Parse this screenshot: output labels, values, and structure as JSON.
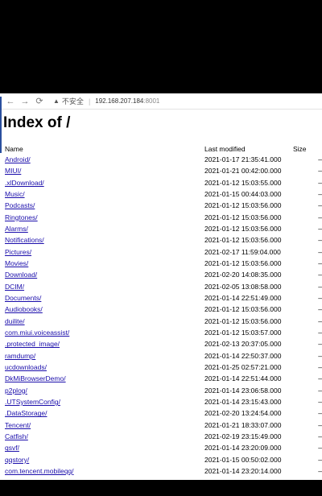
{
  "toolbar": {
    "back_icon": "←",
    "forward_icon": "→",
    "reload_icon": "⟳",
    "security_label": "不安全",
    "url_host": "192.168.207.184",
    "url_port": ":8001"
  },
  "page": {
    "title": "Index of /"
  },
  "table": {
    "headers": [
      "Name",
      "Last modified",
      "Size"
    ],
    "rows": [
      {
        "name": "Android/",
        "modified": "2021-01-17 21:35:41.000",
        "size": "–"
      },
      {
        "name": "MIUI/",
        "modified": "2021-01-21 00:42:00.000",
        "size": "–"
      },
      {
        "name": ".xlDownload/",
        "modified": "2021-01-12 15:03:55.000",
        "size": "–"
      },
      {
        "name": "Music/",
        "modified": "2021-01-15 00:44:03.000",
        "size": "–"
      },
      {
        "name": "Podcasts/",
        "modified": "2021-01-12 15:03:56.000",
        "size": "–"
      },
      {
        "name": "Ringtones/",
        "modified": "2021-01-12 15:03:56.000",
        "size": "–"
      },
      {
        "name": "Alarms/",
        "modified": "2021-01-12 15:03:56.000",
        "size": "–"
      },
      {
        "name": "Notifications/",
        "modified": "2021-01-12 15:03:56.000",
        "size": "–"
      },
      {
        "name": "Pictures/",
        "modified": "2021-02-17 11:59:04.000",
        "size": "–"
      },
      {
        "name": "Movies/",
        "modified": "2021-01-12 15:03:56.000",
        "size": "–"
      },
      {
        "name": "Download/",
        "modified": "2021-02-20 14:08:35.000",
        "size": "–"
      },
      {
        "name": "DCIM/",
        "modified": "2021-02-05 13:08:58.000",
        "size": "–"
      },
      {
        "name": "Documents/",
        "modified": "2021-01-14 22:51:49.000",
        "size": "–"
      },
      {
        "name": "Audiobooks/",
        "modified": "2021-01-12 15:03:56.000",
        "size": "–"
      },
      {
        "name": "duilite/",
        "modified": "2021-01-12 15:03:56.000",
        "size": "–"
      },
      {
        "name": "com.miui.voiceassist/",
        "modified": "2021-01-12 15:03:57.000",
        "size": "–"
      },
      {
        "name": ".protected_image/",
        "modified": "2021-02-13 20:37:05.000",
        "size": "–"
      },
      {
        "name": "ramdump/",
        "modified": "2021-01-14 22:50:37.000",
        "size": "–"
      },
      {
        "name": "ucdownloads/",
        "modified": "2021-01-25 02:57:21.000",
        "size": "–"
      },
      {
        "name": "DkMiBrowserDemo/",
        "modified": "2021-01-14 22:51:44.000",
        "size": "–"
      },
      {
        "name": "p2plog/",
        "modified": "2021-01-14 23:06:58.000",
        "size": "–"
      },
      {
        "name": ".UTSystemConfig/",
        "modified": "2021-01-14 23:15:43.000",
        "size": "–"
      },
      {
        "name": ".DataStorage/",
        "modified": "2021-02-20 13:24:54.000",
        "size": "–"
      },
      {
        "name": "Tencent/",
        "modified": "2021-01-21 18:33:07.000",
        "size": "–"
      },
      {
        "name": "Catfish/",
        "modified": "2021-02-19 23:15:49.000",
        "size": "–"
      },
      {
        "name": "qsvf/",
        "modified": "2021-01-14 23:20:09.000",
        "size": "–"
      },
      {
        "name": "qqstory/",
        "modified": "2021-01-15 00:50:02.000",
        "size": "–"
      },
      {
        "name": "com.tencent.mobileqq/",
        "modified": "2021-01-14 23:20:14.000",
        "size": "–"
      }
    ]
  }
}
